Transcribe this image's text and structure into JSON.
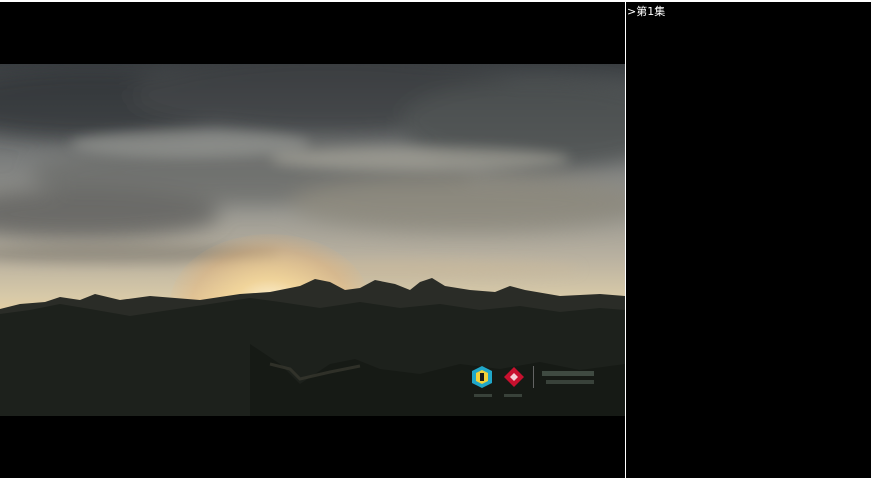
{
  "video": {
    "scene": "sunset-over-great-wall-mountains",
    "watermark_icons": [
      "hexagon-logo-icon",
      "red-diamond-logo-icon"
    ]
  },
  "episodes": {
    "items": [
      {
        "prefix": ">",
        "label": "第1集"
      }
    ]
  },
  "colors": {
    "background": "#000000",
    "divider": "#ffffff",
    "episode_text": "#ffffff",
    "watermark_teal": "#20a7c9",
    "watermark_red": "#c8102e"
  }
}
